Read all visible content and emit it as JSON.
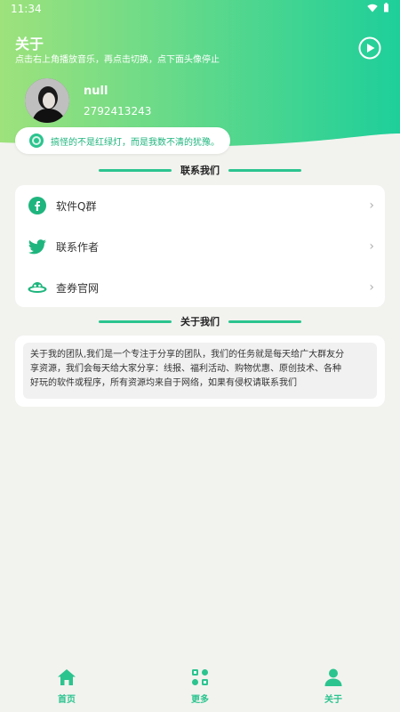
{
  "status_bar": {
    "time": "11:34"
  },
  "header": {
    "title": "关于",
    "subtitle": "点击右上角播放音乐，再点击切换，点下面头像停止"
  },
  "user": {
    "name": "null",
    "id": "2792413243"
  },
  "quote": "搞怪的不是红绿灯，而是我数不清的犹豫。",
  "contact_section": {
    "title": "联系我们",
    "items": [
      {
        "label": "软件Q群",
        "icon": "qq-group-icon"
      },
      {
        "label": "联系作者",
        "icon": "twitter-bird-icon"
      },
      {
        "label": "查券官网",
        "icon": "planet-icon"
      }
    ]
  },
  "about_section": {
    "title": "关于我们",
    "lines": [
      "关于我的团队,我们是一个专注于分享的团队，我们的任务就是每天给广大群友分",
      "享资源，我们会每天给大家分享：线报、福利活动、购物优惠、原创技术、各种",
      "好玩的软件或程序，所有资源均来自于网络，如果有侵权请联系我们"
    ]
  },
  "bottom_nav": [
    {
      "label": "首页",
      "icon": "home-icon"
    },
    {
      "label": "更多",
      "icon": "apps-icon"
    },
    {
      "label": "关于",
      "icon": "user-icon"
    }
  ],
  "colors": {
    "accent": "#2bc48f",
    "header_start": "#9ee27c",
    "header_end": "#1ecf9a"
  }
}
